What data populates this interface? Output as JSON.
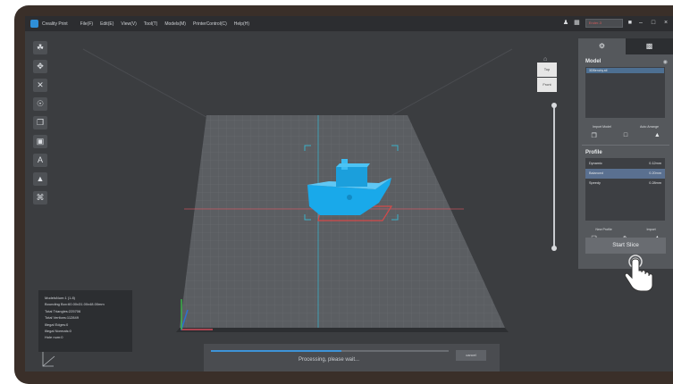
{
  "app": {
    "title": "Creality Print",
    "menu": [
      "File(F)",
      "Edit(E)",
      "View(V)",
      "Tool(T)",
      "Models(M)",
      "PrinterControl(C)",
      "Help(H)"
    ],
    "printer_select": "Ender-3",
    "window_controls": [
      "–",
      "□",
      "×"
    ]
  },
  "left_toolbar": {
    "tools": [
      "☘",
      "✥",
      "✕",
      "☉",
      "❐",
      "▣",
      "A",
      "▲",
      "⌘"
    ]
  },
  "viewport": {
    "view_cube": [
      "Top",
      "Front"
    ],
    "model_info": [
      "ModelsNum:1 (1.8)",
      "Bounding Box:60.00x31.00x48.00mm",
      "Total Triangles:225706",
      "Total Vertices:112849",
      "Illegal Edges:0",
      "Illegal Normals:0",
      "Hole num:0"
    ]
  },
  "progress": {
    "percent": 0.55,
    "text": "Processing, please wait...",
    "cancel_label": "cancel"
  },
  "side_panel": {
    "model_title": "Model",
    "model_items": [
      "3DBenchy.stl"
    ],
    "model_buttons": [
      "Import Model",
      "Auto Arrange"
    ],
    "profile_title": "Profile",
    "profiles": [
      {
        "name": "Dynamic",
        "value": "0.12mm"
      },
      {
        "name": "Balanced",
        "value": "0.20mm"
      },
      {
        "name": "Speedy",
        "value": "0.28mm"
      }
    ],
    "profile_buttons": [
      "New Profile",
      "Import"
    ],
    "start_label": "Start Slice"
  },
  "colors": {
    "model": "#19a9ea",
    "accent": "#3d93d8"
  }
}
